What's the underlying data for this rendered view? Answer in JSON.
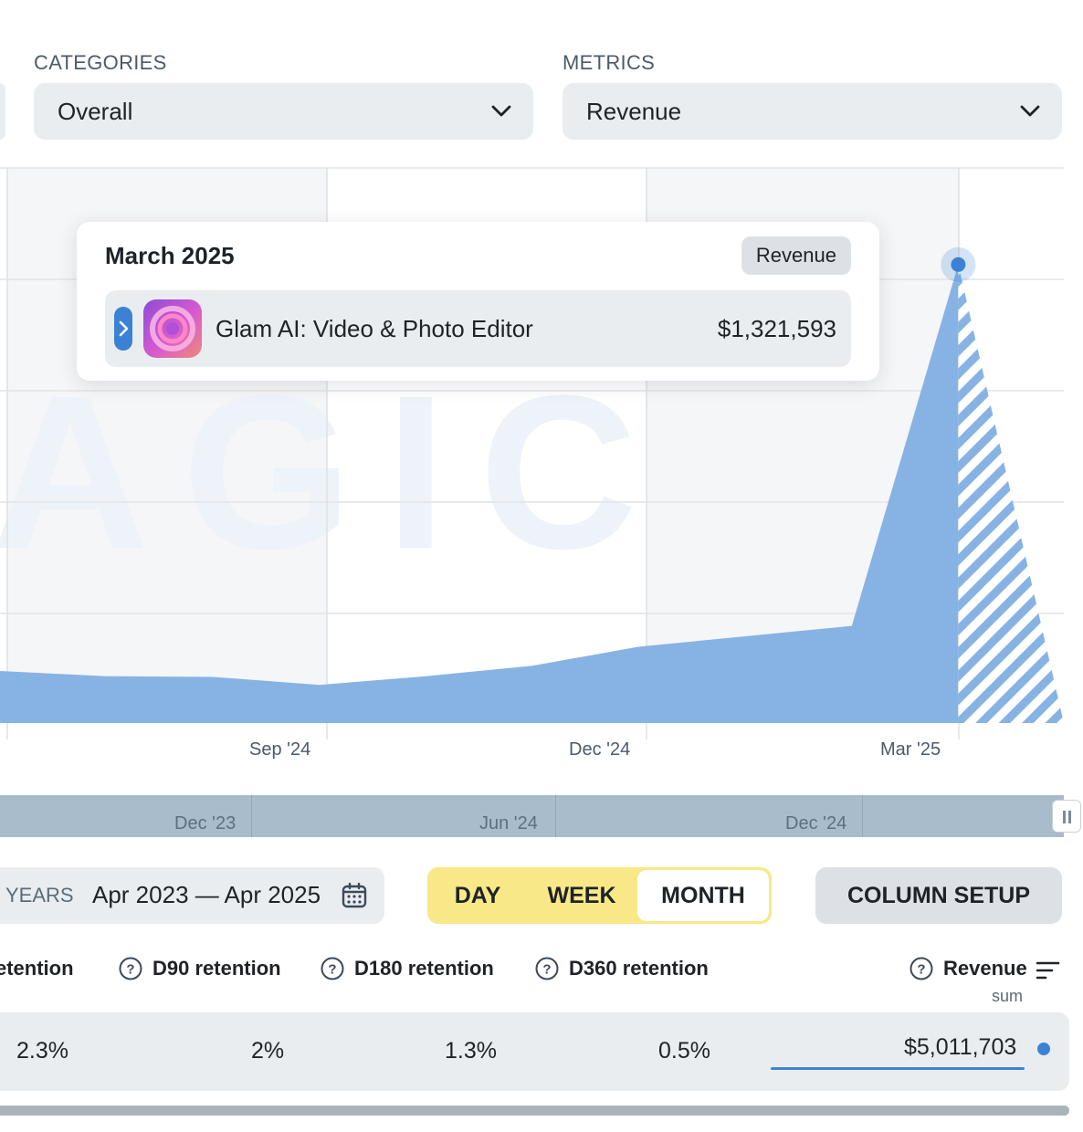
{
  "filters": {
    "categories_label": "CATEGORIES",
    "categories_value": "Overall",
    "metrics_label": "METRICS",
    "metrics_value": "Revenue"
  },
  "watermark_text": "AGIC",
  "tooltip": {
    "title": "March 2025",
    "badge": "Revenue",
    "app_name": "Glam AI: Video & Photo Editor",
    "app_value": "$1,321,593"
  },
  "chart_data": {
    "type": "area",
    "x": [
      "2024-06",
      "2024-07",
      "2024-08",
      "2024-09",
      "2024-10",
      "2024-11",
      "2024-12",
      "2025-01",
      "2025-02",
      "2025-03",
      "2025-04"
    ],
    "series": [
      {
        "values": [
          150000,
          135000,
          133000,
          110000,
          135000,
          165000,
          220000,
          250000,
          280000,
          1321593,
          0
        ],
        "color": "#87b3e4",
        "partial_period_start": "2025-03",
        "partial_period_pattern": "diagonal-stripes"
      }
    ],
    "x_tick_labels": [
      "Sep '24",
      "Dec '24",
      "Mar '25"
    ],
    "highlighted_point": {
      "x": "2025-03",
      "value": 1321593
    },
    "grid": true,
    "ylim": [
      0,
      1400000
    ]
  },
  "navigator": {
    "tick_labels": [
      "Dec '23",
      "Jun '24",
      "Dec '24"
    ]
  },
  "controls": {
    "period_prefix": "YEARS",
    "date_range": "Apr 2023 — Apr 2025",
    "granularity": [
      "DAY",
      "WEEK",
      "MONTH"
    ],
    "granularity_selected": "MONTH",
    "column_setup": "COLUMN SETUP"
  },
  "table": {
    "headers": {
      "retention_partial": "etention",
      "d90": "D90 retention",
      "d180": "D180 retention",
      "d360": "D360 retention",
      "revenue": "Revenue",
      "revenue_sub": "sum"
    },
    "row": {
      "retention_partial": "2.3%",
      "d90": "2%",
      "d180": "1.3%",
      "d360": "0.5%",
      "revenue": "$5,011,703"
    }
  },
  "colors": {
    "accent_blue": "#3b82d6",
    "area_fill": "#87b3e4",
    "granularity_bg": "#f8e887"
  }
}
